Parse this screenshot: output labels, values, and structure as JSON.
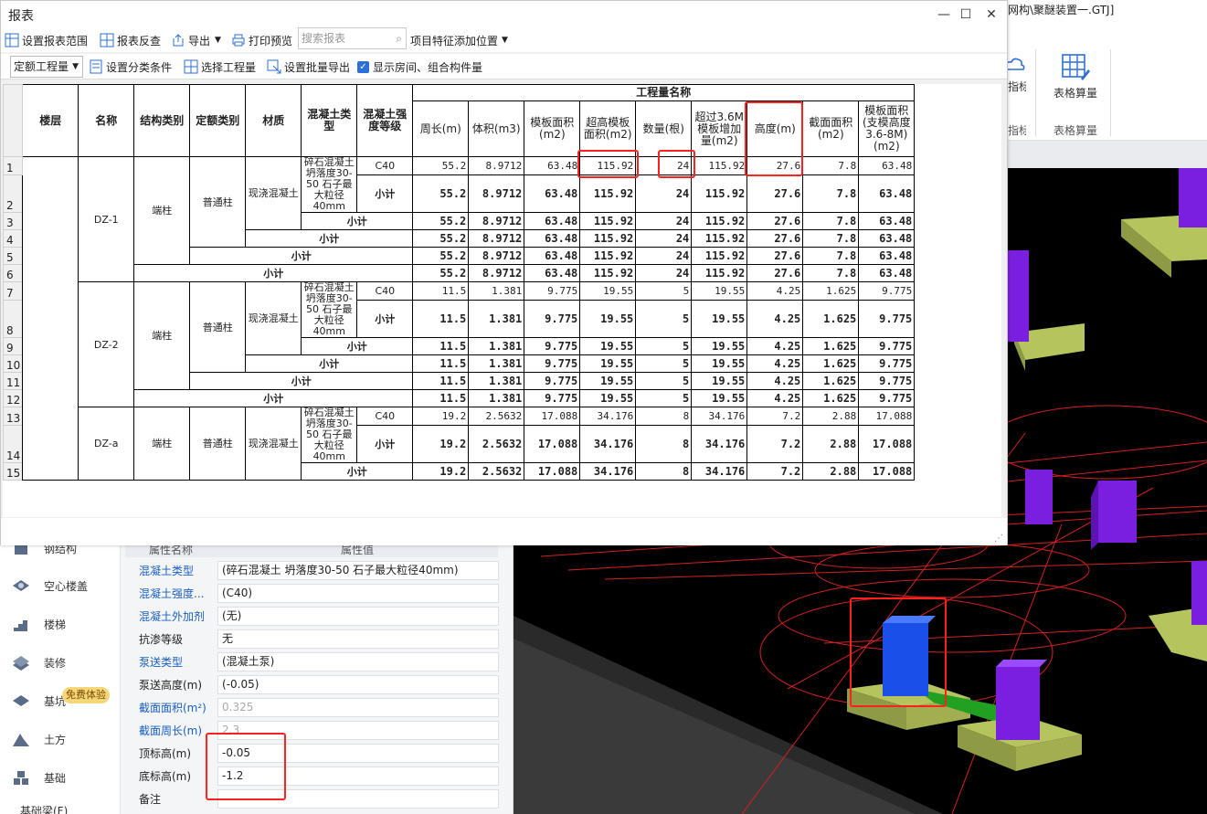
{
  "app": {
    "title_fragment": "网构\\聚醚装置一.GTJ]",
    "ribbon": {
      "btn1_label": "指标",
      "btn2_label": "表格算量",
      "group1_label": "指标",
      "group2_label": "表格算量"
    }
  },
  "report_window": {
    "title": "报表",
    "toolbar1": {
      "set_range": "设置报表范围",
      "reverse": "报表反查",
      "export": "导出",
      "print_preview": "打印预览",
      "search_placeholder": "搜索报表",
      "feature_pos": "项目特征添加位置"
    },
    "toolbar2": {
      "quota_select": "定额工程量",
      "set_classify": "设置分类条件",
      "select_qty": "选择工程量",
      "batch_export": "设置批量导出",
      "show_rooms_label": "显示房间、组合构件量",
      "show_rooms_checked": true
    },
    "table": {
      "headers": {
        "floor": "楼层",
        "name": "名称",
        "struct": "结构类别",
        "quota": "定额类别",
        "material": "材质",
        "concrete_type": "混凝土类型",
        "concrete_grade": "混凝土强度等级",
        "qty_group": "工程量名称",
        "perimeter": "周长(m)",
        "volume": "体积(m3)",
        "formwork": "模板面积(m2)",
        "super_high": "超高模板面积(m2)",
        "count": "数量(根)",
        "over36": "超过3.6M模板增加量(m2)",
        "height": "高度(m)",
        "section": "截面面积(m2)",
        "form36": "模板面积(支模高度3.6-8M)(m2)"
      },
      "row_numbers": [
        "1",
        "2",
        "3",
        "4",
        "5",
        "6",
        "7",
        "8",
        "9",
        "10",
        "11",
        "12",
        "13",
        "14",
        "15"
      ],
      "groups": [
        {
          "name": "DZ-1",
          "struct": "端柱",
          "quota": "普通柱",
          "material": "现浇混凝土",
          "concrete": "碎石混凝土 坍落度30-50 石子最大粒径40mm",
          "grade": "C40",
          "subtotal": "小计",
          "values": [
            "55.2",
            "8.9712",
            "63.48",
            "115.92",
            "24",
            "115.92",
            "27.6",
            "7.8",
            "63.48"
          ]
        },
        {
          "name": "DZ-2",
          "struct": "端柱",
          "quota": "普通柱",
          "material": "现浇混凝土",
          "concrete": "碎石混凝土 坍落度30-50 石子最大粒径40mm",
          "grade": "C40",
          "subtotal": "小计",
          "values": [
            "11.5",
            "1.381",
            "9.775",
            "19.55",
            "5",
            "19.55",
            "4.25",
            "1.625",
            "9.775"
          ]
        },
        {
          "name": "DZ-a",
          "struct": "端柱",
          "quota": "普通柱",
          "material": "现浇混凝土",
          "concrete": "碎石混凝土 坍落度30-50 石子最大粒径40mm",
          "grade": "C40",
          "subtotal": "小计",
          "values": [
            "19.2",
            "2.5632",
            "17.088",
            "34.176",
            "8",
            "34.176",
            "7.2",
            "2.88",
            "17.088"
          ]
        }
      ]
    }
  },
  "left_nav": {
    "items": [
      "钢结构",
      "空心楼盖",
      "楼梯",
      "装修",
      "基坑",
      "土方",
      "基础",
      "基础梁(F)"
    ],
    "trial_badge": "免费体验"
  },
  "properties": {
    "header_name": "属性名称",
    "header_value": "属性值",
    "rows": [
      {
        "name": "混凝土类型",
        "value": "(碎石混凝土 坍落度30-50 石子最大粒径40mm)",
        "link": true
      },
      {
        "name": "混凝土强度...",
        "value": "(C40)",
        "link": true
      },
      {
        "name": "混凝土外加剂",
        "value": "(无)",
        "link": true
      },
      {
        "name": "抗渗等级",
        "value": "无",
        "link": false
      },
      {
        "name": "泵送类型",
        "value": "(混凝土泵)",
        "link": true
      },
      {
        "name": "泵送高度(m)",
        "value": "(-0.05)",
        "link": false
      },
      {
        "name": "截面面积(m²)",
        "value": "0.325",
        "link": true,
        "gray": true
      },
      {
        "name": "截面周长(m)",
        "value": "2.3",
        "link": true,
        "gray": true
      },
      {
        "name": "顶标高(m)",
        "value": "-0.05",
        "link": false
      },
      {
        "name": "底标高(m)",
        "value": "-1.2",
        "link": false
      },
      {
        "name": "备注",
        "value": "",
        "link": false
      }
    ]
  },
  "colors": {
    "highlight_red": "#ff2020",
    "viewport_bg": "#000000",
    "column_purple": "#7a1fe0",
    "column_blue": "#1a4fe8",
    "footing": "#b6c45e"
  }
}
